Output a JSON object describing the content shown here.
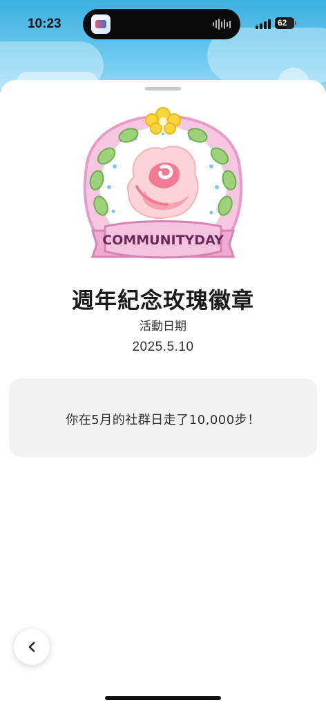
{
  "status_bar": {
    "time": "10:23",
    "battery": "62",
    "island_app_icon": "app-icon"
  },
  "sheet": {
    "badge": {
      "ribbon_text": "COMMUNITYDAY",
      "icon": "rose-badge-icon"
    },
    "title": "週年紀念玫瑰徽章",
    "date_label": "活動日期",
    "date_value": "2025.5.10",
    "message": "你在5月的社群日走了10,000步！"
  },
  "navigation": {
    "back_icon": "chevron-left-icon"
  },
  "colors": {
    "sky_top": "#3ab0e2",
    "card_bg": "#f2f2f2",
    "ribbon_pink": "#f0a9cf",
    "ribbon_text": "#6a2a55",
    "rose_pink": "#f27a93"
  }
}
